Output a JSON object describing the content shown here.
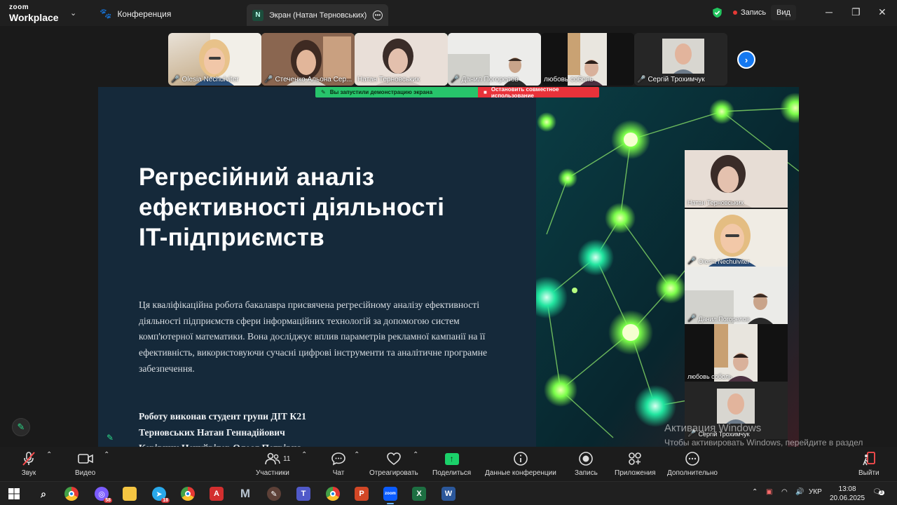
{
  "app": {
    "brand_small": "zoom",
    "brand_large": "Workplace",
    "conference_label": "Конференция",
    "screen_tab_badge": "N",
    "screen_tab_label": "Экран (Натан Терновських)",
    "recording_label": "Запись",
    "view_label": "Вид",
    "accent": "#2ddc8a"
  },
  "thumbnails": [
    {
      "name": "Olesia Nechuiviter",
      "muted": true
    },
    {
      "name": "Стеченко Альона Сер...",
      "muted": true
    },
    {
      "name": "Натан Терновських",
      "muted": false,
      "active": true
    },
    {
      "name": "Данил Погорелов",
      "muted": true
    },
    {
      "name": "любовь соболь",
      "muted": false
    },
    {
      "name": "Сергій Трохимчук",
      "muted": true
    }
  ],
  "sharebar": {
    "started": "Вы запустили демонстрацию экрана",
    "stop": "Остановить совместное использование"
  },
  "slide": {
    "title_lines": [
      "Регресійний аналіз",
      "ефективності діяльності",
      "IT-підприємств"
    ],
    "body": "Ця кваліфікаційна робота бакалавра присвячена регресійному аналізу ефективності діяльності підприємств сфери інформаційних технологій за допомогою систем комп'ютерної математики. Вона досліджує вплив параметрів рекламної кампанії на її ефективність, використовуючи сучасні цифрові інструменти та аналітичне програмне забезпечення.",
    "author_lines": [
      "Роботу виконав студент групи ДІТ К21",
      "Терновських Натан Геннадійович",
      "Керівник Нечуйвітер Олеся Петрівна"
    ]
  },
  "side_participants": [
    {
      "name": "Натан Терновських",
      "muted": false,
      "active": true
    },
    {
      "name": "Olesia Nechuiviter",
      "muted": true
    },
    {
      "name": "Данил Погорелов",
      "muted": true
    },
    {
      "name": "любовь соболь",
      "muted": false
    },
    {
      "name": "Сергій Трохимчук",
      "muted": true
    }
  ],
  "watermark": {
    "title": "Активация Windows",
    "text": "Чтобы активировать Windows, перейдите в раздел \"Параметры\"."
  },
  "toolbar": {
    "audio": "Звук",
    "video": "Видео",
    "participants": "Участники",
    "participants_count": "11",
    "chat": "Чат",
    "react": "Отреагировать",
    "share": "Поделиться",
    "info": "Данные конференции",
    "record": "Запись",
    "apps": "Приложения",
    "more": "Дополнительно",
    "leave": "Выйти"
  },
  "taskbar": {
    "badge_count": "58",
    "badge_count2": "18",
    "lang": "УКР",
    "time": "13:08",
    "date": "20.06.2025",
    "notif": "3"
  }
}
